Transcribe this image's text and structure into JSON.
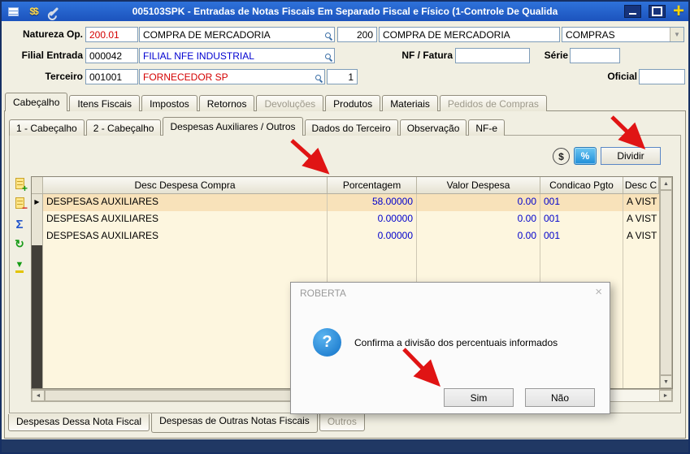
{
  "window": {
    "title": "005103SPK - Entradas de Notas Fiscais Em Separado Fiscal e Físico (1-Controle De Qualida"
  },
  "titlebar": {
    "money_glyph": "$$",
    "plus_glyph": "+"
  },
  "form": {
    "natureza": {
      "label": "Natureza Op.",
      "code": "200.01",
      "desc": "COMPRA DE MERCADORIA",
      "num": "200",
      "desc2": "COMPRA DE MERCADORIA",
      "tipo": "COMPRAS"
    },
    "filial": {
      "label": "Filial Entrada",
      "code": "000042",
      "desc": "FILIAL NFE INDUSTRIAL"
    },
    "nf": {
      "label": "NF / Fatura",
      "value": ""
    },
    "serie": {
      "label": "Série",
      "value": ""
    },
    "terceiro": {
      "label": "Terceiro",
      "code": "001001",
      "desc": "FORNECEDOR SP",
      "qty": "1"
    },
    "oficial": {
      "label": "Oficial",
      "value": ""
    }
  },
  "main_tabs": [
    {
      "label": "Cabeçalho",
      "active": true
    },
    {
      "label": "Itens Fiscais"
    },
    {
      "label": "Impostos"
    },
    {
      "label": "Retornos"
    },
    {
      "label": "Devoluções",
      "disabled": true
    },
    {
      "label": "Produtos"
    },
    {
      "label": "Materiais"
    },
    {
      "label": "Pedidos de Compras",
      "disabled": true
    }
  ],
  "sub_tabs": [
    {
      "label": "1 - Cabeçalho"
    },
    {
      "label": "2 - Cabeçalho"
    },
    {
      "label": "Despesas Auxiliares / Outros",
      "active": true
    },
    {
      "label": "Dados do Terceiro"
    },
    {
      "label": "Observação"
    },
    {
      "label": "NF-e"
    }
  ],
  "tools": {
    "dollar": "$",
    "percent": "%",
    "dividir": "Dividir"
  },
  "grid": {
    "columns": [
      "Desc Despesa Compra",
      "Porcentagem",
      "Valor Despesa",
      "Condicao Pgto",
      "Desc C"
    ],
    "rows": [
      {
        "desc": "DESPESAS AUXILIARES",
        "porcentagem": "58.00000",
        "valor": "0.00",
        "condicao": "001",
        "desc_cond": "A VIST"
      },
      {
        "desc": "DESPESAS AUXILIARES",
        "porcentagem": "0.00000",
        "valor": "0.00",
        "condicao": "001",
        "desc_cond": "A VIST"
      },
      {
        "desc": "DESPESAS AUXILIARES",
        "porcentagem": "0.00000",
        "valor": "0.00",
        "condicao": "001",
        "desc_cond": "A VIST"
      }
    ]
  },
  "bottom_tabs": [
    {
      "label": "Despesas Dessa Nota Fiscal"
    },
    {
      "label": "Despesas de Outras Notas Fiscais",
      "active": true
    },
    {
      "label": "Outros",
      "disabled": true
    }
  ],
  "dialog": {
    "title": "ROBERTA",
    "message": "Confirma a divisão dos percentuais informados",
    "question_mark": "?",
    "yes_label": "Sim",
    "no_label": "Não"
  },
  "icons": {
    "row_marker": "▶",
    "close": "×",
    "scroll_left": "◄",
    "scroll_right": "►",
    "scroll_up": "▲",
    "scroll_down": "▼",
    "combo_arrow": "▼",
    "sigma": "Σ",
    "refresh": "↻",
    "down_transfer": "▼",
    "add": "+",
    "remove": "−"
  },
  "colors": {
    "titlebar_blue": "#1f5fd0",
    "grid_background": "#fdf6df",
    "selected_row": "#f8e2ba",
    "value_blue": "#0000cc",
    "alert_red": "#d40000",
    "annotation_arrow_red": "#e01414",
    "bottom_bar_navy": "#203864"
  }
}
